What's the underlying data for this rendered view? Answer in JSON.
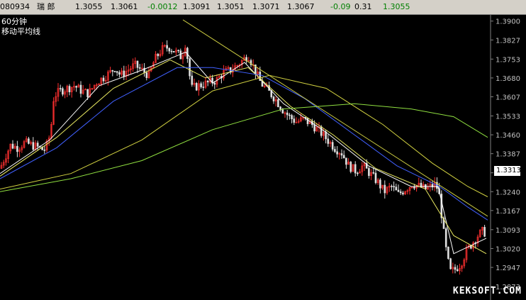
{
  "header": {
    "code": "080934",
    "name": "瑞 郎",
    "open": "1.3055",
    "high": "1.3061",
    "change": "-0.0012",
    "v4": "1.3091",
    "low": "1.3051",
    "v6": "1.3071",
    "close": "1.3067",
    "change2": "-0.09",
    "v9": "0.31",
    "last": "1.3055"
  },
  "legend": {
    "period": "60分钟",
    "indicator": "移动平均线"
  },
  "current_price": "1.3313",
  "watermark": "KEKSOFT.COM",
  "colors": {
    "candle_up": "#ff3030",
    "candle_down": "#e0e0e0",
    "ma5": "#ffffff",
    "ma10": "#e8e860",
    "ma20": "#4060ff",
    "ma60": "#d0d040",
    "ma120": "#90e040",
    "trend": "#c8c840"
  },
  "chart_data": {
    "type": "candlestick",
    "ylim": [
      1.2873,
      1.3902
    ],
    "y_ticks": [
      "1.3900",
      "1.3827",
      "1.3753",
      "1.3680",
      "1.3607",
      "1.3533",
      "1.3460",
      "1.3387",
      "1.3313",
      "1.3240",
      "1.3167",
      "1.3093",
      "1.3020",
      "1.2947",
      "1.2873"
    ],
    "close_path": [
      [
        0,
        1.333
      ],
      [
        8,
        1.338
      ],
      [
        15,
        1.342
      ],
      [
        25,
        1.341
      ],
      [
        35,
        1.343
      ],
      [
        45,
        1.342
      ],
      [
        55,
        1.341
      ],
      [
        62,
        1.34
      ],
      [
        68,
        1.343
      ],
      [
        72,
        1.349
      ],
      [
        76,
        1.361
      ],
      [
        85,
        1.363
      ],
      [
        95,
        1.364
      ],
      [
        105,
        1.365
      ],
      [
        115,
        1.363
      ],
      [
        125,
        1.362
      ],
      [
        135,
        1.366
      ],
      [
        145,
        1.368
      ],
      [
        155,
        1.37
      ],
      [
        162,
        1.372
      ],
      [
        170,
        1.369
      ],
      [
        180,
        1.371
      ],
      [
        190,
        1.373
      ],
      [
        200,
        1.371
      ],
      [
        210,
        1.369
      ],
      [
        218,
        1.375
      ],
      [
        228,
        1.379
      ],
      [
        238,
        1.38
      ],
      [
        248,
        1.378
      ],
      [
        256,
        1.376
      ],
      [
        262,
        1.382
      ],
      [
        266,
        1.372
      ],
      [
        270,
        1.364
      ],
      [
        280,
        1.365
      ],
      [
        292,
        1.366
      ],
      [
        305,
        1.367
      ],
      [
        315,
        1.37
      ],
      [
        325,
        1.371
      ],
      [
        335,
        1.373
      ],
      [
        343,
        1.375
      ],
      [
        350,
        1.377
      ],
      [
        358,
        1.372
      ],
      [
        368,
        1.366
      ],
      [
        378,
        1.363
      ],
      [
        388,
        1.36
      ],
      [
        398,
        1.356
      ],
      [
        408,
        1.353
      ],
      [
        418,
        1.351
      ],
      [
        428,
        1.352
      ],
      [
        440,
        1.35
      ],
      [
        452,
        1.347
      ],
      [
        462,
        1.344
      ],
      [
        472,
        1.341
      ],
      [
        482,
        1.339
      ],
      [
        492,
        1.334
      ],
      [
        502,
        1.332
      ],
      [
        512,
        1.334
      ],
      [
        522,
        1.331
      ],
      [
        532,
        1.328
      ],
      [
        542,
        1.324
      ],
      [
        552,
        1.326
      ],
      [
        562,
        1.323
      ],
      [
        572,
        1.325
      ],
      [
        582,
        1.327
      ],
      [
        592,
        1.326
      ],
      [
        600,
        1.325
      ],
      [
        608,
        1.326
      ],
      [
        615,
        1.327
      ],
      [
        620,
        1.322
      ],
      [
        625,
        1.31
      ],
      [
        630,
        1.3
      ],
      [
        635,
        1.293
      ],
      [
        642,
        1.294
      ],
      [
        650,
        1.296
      ],
      [
        658,
        1.301
      ],
      [
        666,
        1.304
      ],
      [
        674,
        1.307
      ],
      [
        682,
        1.309
      ],
      [
        686,
        1.307
      ]
    ],
    "moving_averages": [
      {
        "key": "ma5",
        "points": [
          [
            0,
            1.331
          ],
          [
            70,
            1.344
          ],
          [
            140,
            1.365
          ],
          [
            200,
            1.371
          ],
          [
            262,
            1.378
          ],
          [
            300,
            1.366
          ],
          [
            345,
            1.374
          ],
          [
            400,
            1.358
          ],
          [
            460,
            1.347
          ],
          [
            520,
            1.334
          ],
          [
            580,
            1.326
          ],
          [
            618,
            1.326
          ],
          [
            640,
            1.3
          ],
          [
            686,
            1.306
          ]
        ]
      },
      {
        "key": "ma10",
        "points": [
          [
            0,
            1.33
          ],
          [
            80,
            1.345
          ],
          [
            160,
            1.364
          ],
          [
            240,
            1.375
          ],
          [
            290,
            1.368
          ],
          [
            350,
            1.372
          ],
          [
            410,
            1.357
          ],
          [
            470,
            1.346
          ],
          [
            530,
            1.333
          ],
          [
            600,
            1.325
          ],
          [
            640,
            1.307
          ],
          [
            686,
            1.3
          ]
        ]
      },
      {
        "key": "ma20",
        "points": [
          [
            0,
            1.329
          ],
          [
            80,
            1.341
          ],
          [
            160,
            1.359
          ],
          [
            250,
            1.372
          ],
          [
            300,
            1.372
          ],
          [
            370,
            1.369
          ],
          [
            430,
            1.36
          ],
          [
            500,
            1.346
          ],
          [
            560,
            1.334
          ],
          [
            620,
            1.326
          ],
          [
            660,
            1.318
          ],
          [
            688,
            1.313
          ]
        ]
      },
      {
        "key": "ma60",
        "points": [
          [
            0,
            1.325
          ],
          [
            100,
            1.331
          ],
          [
            200,
            1.344
          ],
          [
            300,
            1.363
          ],
          [
            380,
            1.369
          ],
          [
            460,
            1.364
          ],
          [
            540,
            1.35
          ],
          [
            610,
            1.335
          ],
          [
            660,
            1.326
          ],
          [
            688,
            1.322
          ]
        ]
      },
      {
        "key": "ma120",
        "points": [
          [
            0,
            1.324
          ],
          [
            100,
            1.329
          ],
          [
            200,
            1.336
          ],
          [
            300,
            1.348
          ],
          [
            400,
            1.356
          ],
          [
            500,
            1.358
          ],
          [
            580,
            1.356
          ],
          [
            640,
            1.353
          ],
          [
            688,
            1.345
          ]
        ]
      },
      {
        "key": "trend",
        "points": [
          [
            258,
            1.3905
          ],
          [
            688,
            1.3145
          ]
        ]
      }
    ]
  }
}
